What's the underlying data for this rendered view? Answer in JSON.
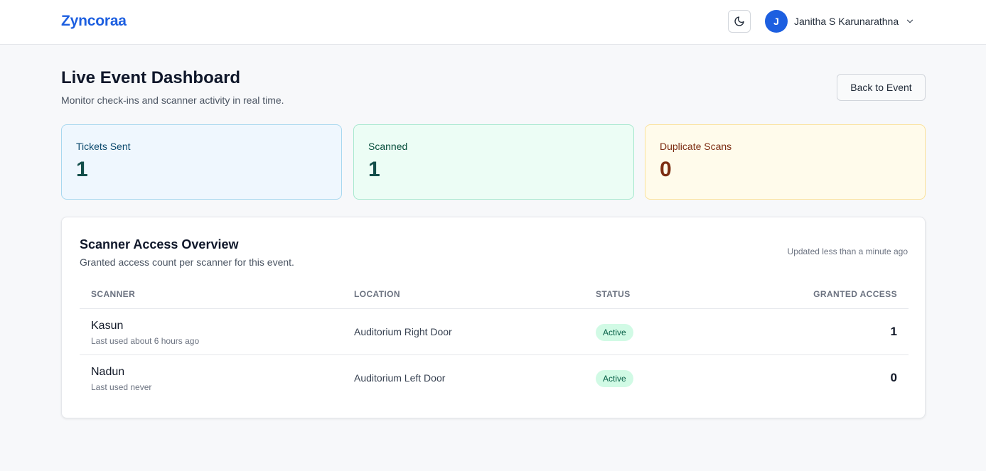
{
  "header": {
    "brand": "Zyncoraa",
    "user_initial": "J",
    "user_name": "Janitha S Karunarathna",
    "icons": {
      "theme": "moon-icon",
      "menu": "chevron-down-icon"
    }
  },
  "page": {
    "title": "Live Event Dashboard",
    "subtitle": "Monitor check-ins and scanner activity in real time.",
    "back_label": "Back to Event"
  },
  "stats": [
    {
      "label": "Tickets Sent",
      "value": "1",
      "accent": "#eff7fe"
    },
    {
      "label": "Scanned",
      "value": "1",
      "accent": "#ecfdf5"
    },
    {
      "label": "Duplicate Scans",
      "value": "0",
      "accent": "#fffbeb"
    }
  ],
  "scanners": {
    "title": "Scanner Access Overview",
    "subtitle": "Granted access count per scanner for this event.",
    "updated": "Updated less than a minute ago",
    "columns": [
      "SCANNER",
      "LOCATION",
      "STATUS",
      "GRANTED ACCESS"
    ],
    "rows": [
      {
        "name": "Kasun",
        "last_used": "Last used about 6 hours ago",
        "location": "Auditorium Right Door",
        "status": "Active",
        "granted": "1"
      },
      {
        "name": "Nadun",
        "last_used": "Last used never",
        "location": "Auditorium Left Door",
        "status": "Active",
        "granted": "0"
      }
    ]
  },
  "colors": {
    "brand": "#1d5fe0",
    "active_badge_bg": "#d1fae5",
    "active_badge_text": "#065f46"
  }
}
